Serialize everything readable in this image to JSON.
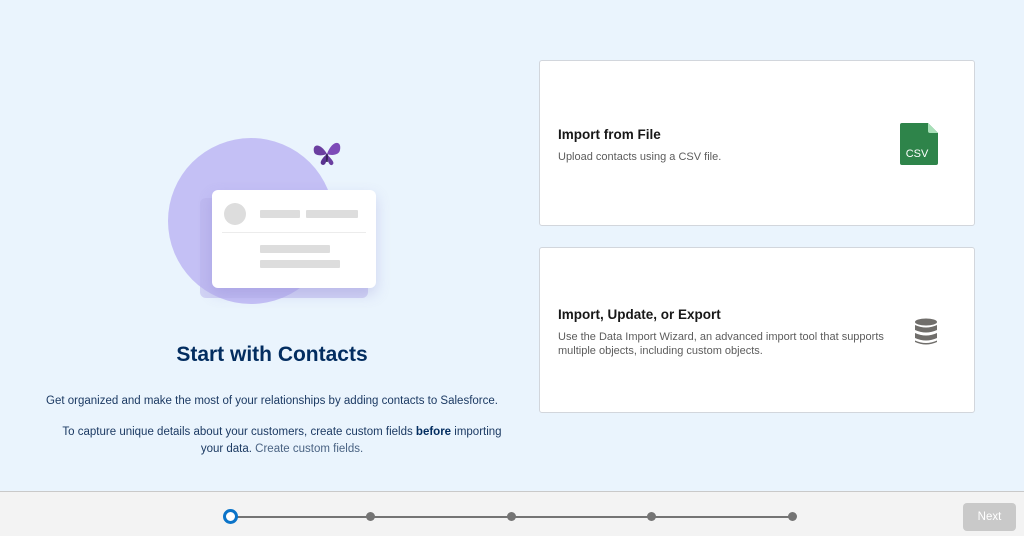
{
  "intro": {
    "title": "Start with Contacts",
    "description": "Get organized and make the most of your relationships by adding contacts to Salesforce.",
    "custom_fields_text_before": "To capture unique details about your customers, create custom fields ",
    "custom_fields_bold": "before",
    "custom_fields_text_after": " importing your data.",
    "custom_fields_link": "Create custom fields."
  },
  "options": [
    {
      "title": "Import from File",
      "description": "Upload contacts using a CSV file.",
      "icon": "csv-file-icon",
      "icon_label": "CSV",
      "icon_color": "#2e844a"
    },
    {
      "title": "Import, Update, or Export",
      "description": "Use the Data Import Wizard, an advanced import tool that supports multiple objects, including custom objects.",
      "icon": "database-icon",
      "icon_color": "#706e6b"
    }
  ],
  "footer": {
    "progress": {
      "total_steps": 5,
      "current_step": 1
    },
    "next_label": "Next",
    "next_disabled": true
  },
  "colors": {
    "background": "#eaf4fd",
    "title": "#032d60",
    "active_step": "#0b74c9",
    "illustration_circle": "#c4c0f5"
  }
}
